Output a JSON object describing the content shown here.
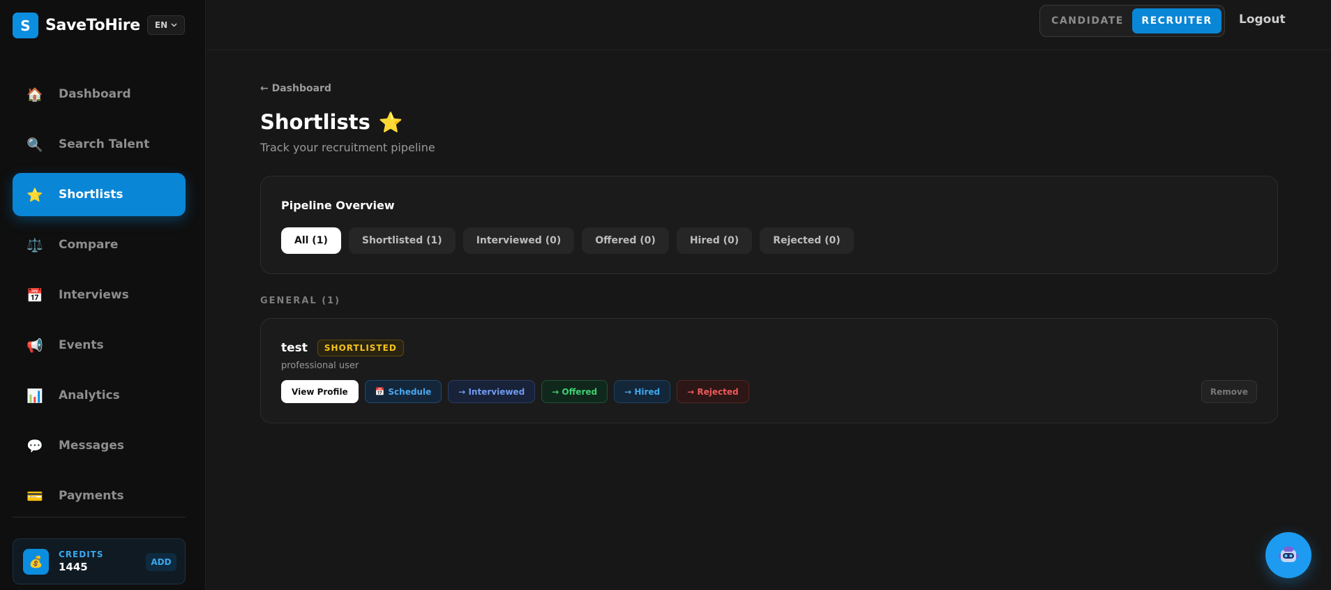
{
  "brand": {
    "logo_letter": "S",
    "name": "SaveToHire",
    "lang": "EN"
  },
  "sidebar": {
    "items": [
      {
        "label": "Dashboard",
        "icon": "🏠"
      },
      {
        "label": "Search Talent",
        "icon": "🔍"
      },
      {
        "label": "Shortlists",
        "icon": "⭐"
      },
      {
        "label": "Compare",
        "icon": "⚖️"
      },
      {
        "label": "Interviews",
        "icon": "📅"
      },
      {
        "label": "Events",
        "icon": "📢"
      },
      {
        "label": "Analytics",
        "icon": "📊"
      },
      {
        "label": "Messages",
        "icon": "💬"
      },
      {
        "label": "Payments",
        "icon": "💳"
      }
    ],
    "active": "Shortlists",
    "credits": {
      "label": "CREDITS",
      "value": "1445",
      "add": "ADD",
      "icon": "💰"
    }
  },
  "header": {
    "roles": [
      "CANDIDATE",
      "RECRUITER"
    ],
    "active_role": "RECRUITER",
    "logout": "Logout"
  },
  "main": {
    "back": "← Dashboard",
    "title": "Shortlists",
    "title_icon": "⭐",
    "subtitle": "Track your recruitment pipeline",
    "pipeline": {
      "title": "Pipeline Overview",
      "filters": [
        "All (1)",
        "Shortlisted (1)",
        "Interviewed (0)",
        "Offered (0)",
        "Hired (0)",
        "Rejected (0)"
      ],
      "active_filter": "All (1)"
    },
    "section": "GENERAL (1)",
    "candidate": {
      "name": "test",
      "status": "SHORTLISTED",
      "role": "professional user",
      "actions": {
        "view": "View Profile",
        "schedule": "Schedule",
        "schedule_icon": "📅",
        "interviewed": "→ Interviewed",
        "offered": "→ Offered",
        "hired": "→ Hired",
        "rejected": "→ Rejected"
      },
      "remove": "Remove"
    }
  },
  "colors": {
    "accent": "#0a86d6",
    "badge": "#f4c31f",
    "background": "#171717"
  }
}
